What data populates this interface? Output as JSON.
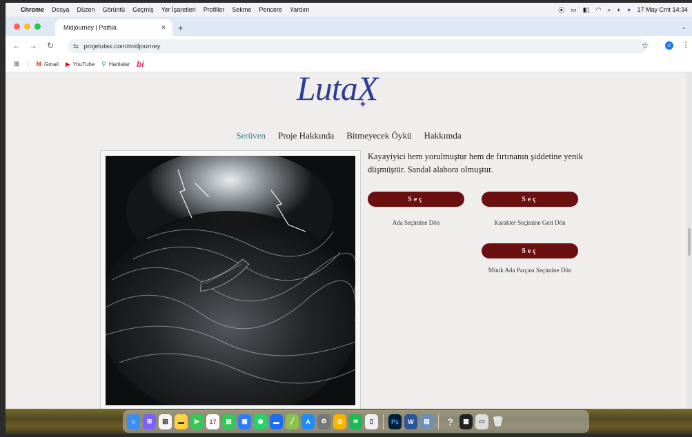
{
  "menubar": {
    "app": "Chrome",
    "items": [
      "Dosya",
      "Düzen",
      "Görüntü",
      "Geçmiş",
      "Yer İşaretleri",
      "Profiller",
      "Sekme",
      "Pencere",
      "Yardım"
    ],
    "datetime": "17 May Cmt 14:34"
  },
  "tab": {
    "title": "Midjourney | Pathia",
    "close": "×",
    "new": "+"
  },
  "address": {
    "url": "projelutax.com/midjourney"
  },
  "bookmarks": [
    {
      "label": "Gmail",
      "icon": "gmail-icon"
    },
    {
      "label": "YouTube",
      "icon": "youtube-icon"
    },
    {
      "label": "Haritalar",
      "icon": "maps-icon"
    }
  ],
  "bookmark_bi": "bi",
  "site": {
    "logo": "LutaX",
    "nav": [
      "Serüven",
      "Proje Hakkında",
      "Bitmeyecek Öykü",
      "Hakkımda"
    ],
    "story": "Kayayiyici hem yorulmuştur hem de fırtınanın şiddetine yenik düşmüştür. Sandal alabora olmuştur.",
    "choices": [
      {
        "button": "Seç",
        "label": "Ada Seçimine Dön"
      },
      {
        "button": "Seç",
        "label": "Karakter Seçimine Geri Dön"
      },
      {
        "button": "Seç",
        "label": "Minik Ada Parçası Seçimine Dön"
      }
    ]
  },
  "colors": {
    "button": "#6b0f10",
    "nav_active": "#3d7d83",
    "logo": "#2d3d94"
  }
}
